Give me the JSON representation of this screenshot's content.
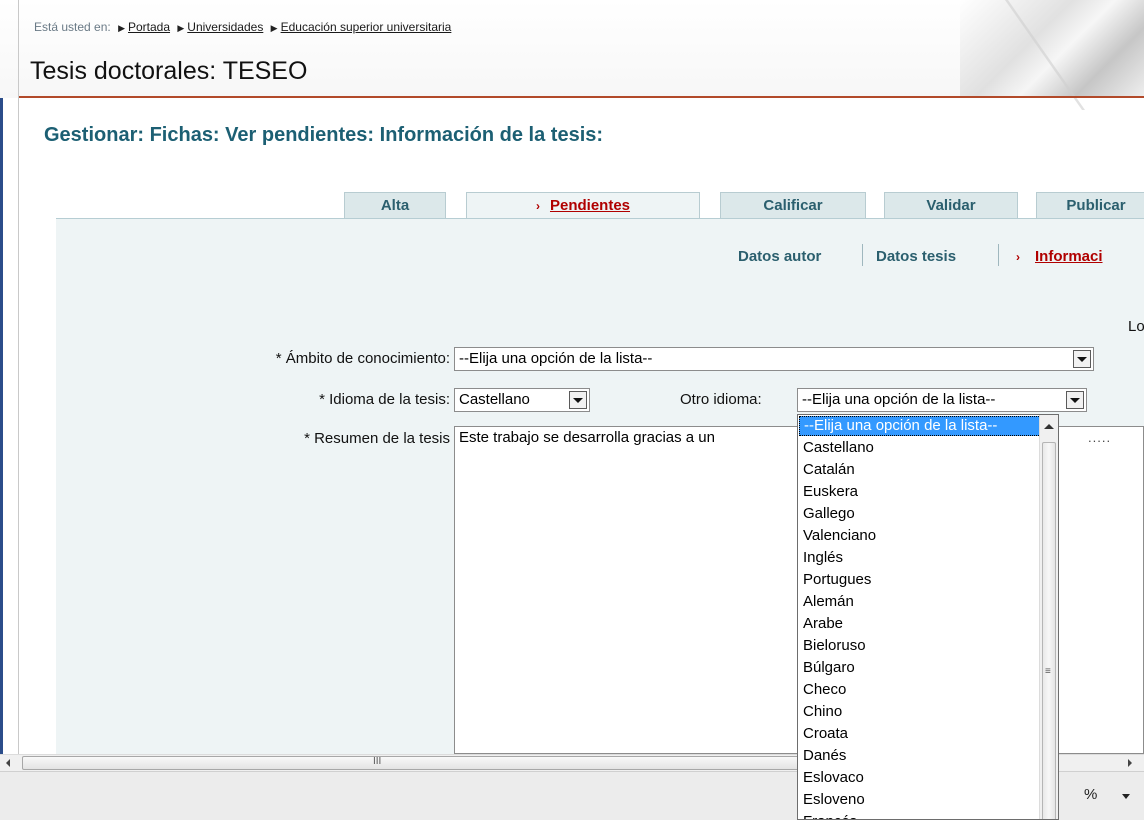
{
  "breadcrumb": {
    "prefix": "Está usted en:",
    "items": [
      "Portada",
      "Universidades",
      "Educación superior universitaria"
    ]
  },
  "page_title": "Tesis doctorales: TESEO",
  "subtitle": "Gestionar: Fichas: Ver pendientes: Información de la tesis:",
  "tabs": [
    {
      "label": "Alta"
    },
    {
      "label": "Pendientes"
    },
    {
      "label": "Calificar"
    },
    {
      "label": "Validar"
    },
    {
      "label": "Publicar"
    }
  ],
  "subtabs": [
    "Datos autor",
    "Datos tesis",
    "Informaci"
  ],
  "cut_label": "Lo",
  "form": {
    "ambito_label": "* Ámbito de conocimiento:",
    "ambito_value": "--Elija una opción de la lista--",
    "idioma_label": "* Idioma de la tesis:",
    "idioma_value": "Castellano",
    "otro_label": "Otro idioma:",
    "otro_value": "--Elija una opción de la lista--",
    "resumen_label": "* Resumen de la tesis",
    "resumen_text": "Este trabajo se desarrolla gracias a un",
    "resumen_trailing": "....."
  },
  "dropdown_options": [
    "--Elija una opción de la lista--",
    "Castellano",
    "Catalán",
    "Euskera",
    "Gallego",
    "Valenciano",
    "Inglés",
    "Portugues",
    "Alemán",
    "Arabe",
    "Bieloruso",
    "Búlgaro",
    "Checo",
    "Chino",
    "Croata",
    "Danés",
    "Eslovaco",
    "Esloveno",
    "Francés"
  ],
  "statusbar": {
    "zoom": "%"
  },
  "hscroll_grip": "III",
  "colors": {
    "accent": "#1c5f73",
    "active": "#b00000",
    "tab_bg": "#dce8ea",
    "panel_bg": "#eef4f5",
    "selection": "#3399ff"
  }
}
